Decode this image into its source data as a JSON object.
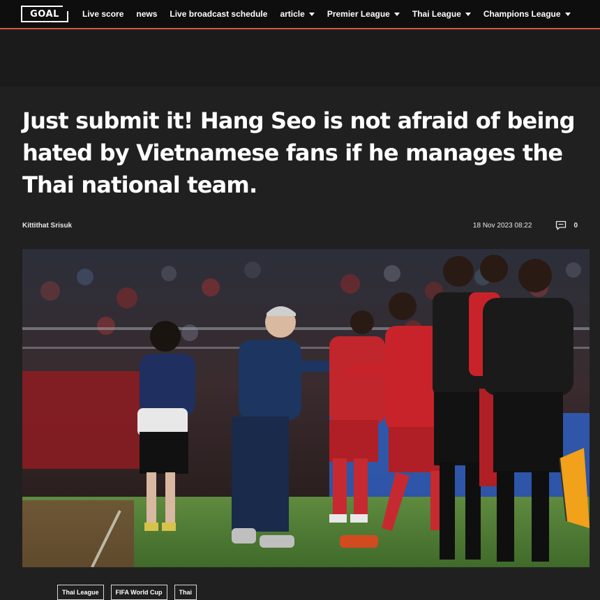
{
  "brand": {
    "logo_text": "GOAL"
  },
  "nav": {
    "items": [
      {
        "label": "Live score",
        "has_dropdown": false
      },
      {
        "label": "news",
        "has_dropdown": false
      },
      {
        "label": "Live broadcast schedule",
        "has_dropdown": false
      },
      {
        "label": "article",
        "has_dropdown": true
      },
      {
        "label": "Premier League",
        "has_dropdown": true
      },
      {
        "label": "Thai League",
        "has_dropdown": true
      },
      {
        "label": "Champions League",
        "has_dropdown": true
      }
    ]
  },
  "article": {
    "title": "Just submit it! Hang Seo is not afraid of being hated by Vietnamese fans if he manages the Thai national team.",
    "author": "Kittithat Srisuk",
    "timestamp": "18 Nov 2023 08:22",
    "comment_count": "0",
    "tags": [
      "Thai League",
      "FIFA World Cup",
      "Thai"
    ]
  },
  "colors": {
    "page_bg": "#202020",
    "nav_bg": "#0e0e0e",
    "nav_accent": "#d9533f",
    "text": "#ffffff"
  },
  "icons": {
    "comment": "comment-icon",
    "dropdown": "chevron-down-icon"
  }
}
